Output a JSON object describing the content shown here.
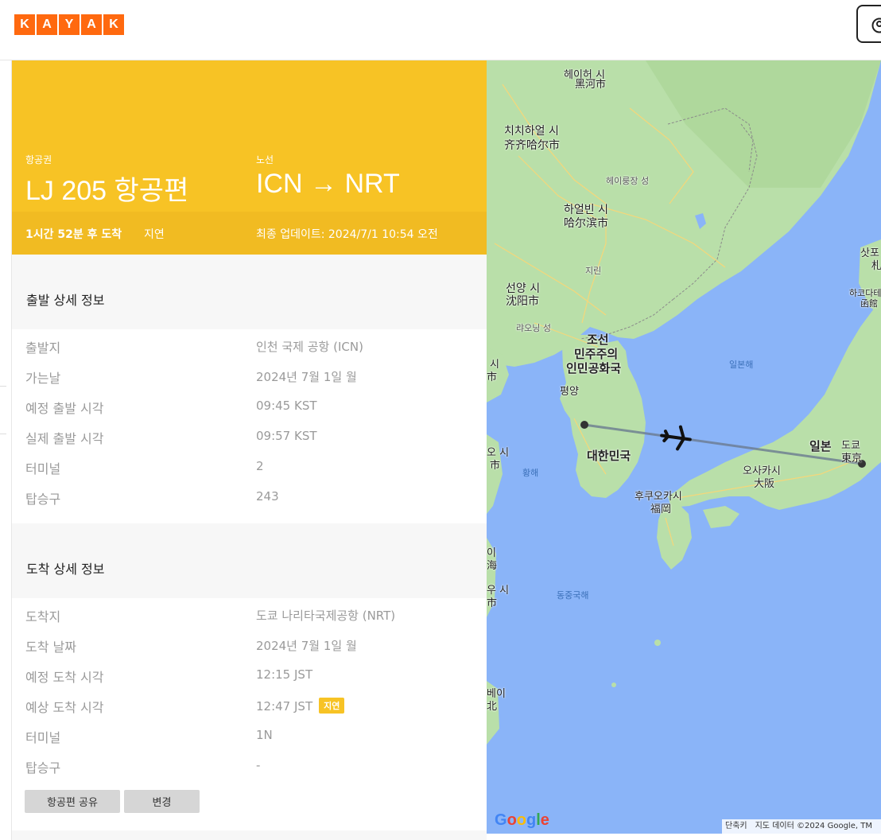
{
  "header": {
    "logo_letters": [
      "K",
      "A",
      "Y",
      "A",
      "K"
    ],
    "brand_color": "#ff690f"
  },
  "hero": {
    "flight_label": "항공권",
    "flight_title": "LJ 205 항공편",
    "route_label": "노선",
    "route_title": "ICN → NRT",
    "arrival_countdown": "1시간 52분 후 도착",
    "status": "지연",
    "last_update": "최종 업데이트: 2024/7/1 10:54 오전",
    "color": "#f7c325"
  },
  "departure": {
    "heading": "출발 상세 정보",
    "rows": [
      {
        "label": "출발지",
        "value": "인천 국제 공항 (ICN)"
      },
      {
        "label": "가는날",
        "value": "2024년 7월 1일 월"
      },
      {
        "label": "예정 출발 시각",
        "value": "09:45 KST"
      },
      {
        "label": "실제 출발 시각",
        "value": "09:57 KST"
      },
      {
        "label": "터미널",
        "value": "2"
      },
      {
        "label": "탑승구",
        "value": "243"
      }
    ]
  },
  "arrival": {
    "heading": "도착 상세 정보",
    "rows": [
      {
        "label": "도착지",
        "value": "도쿄 나리타국제공항 (NRT)"
      },
      {
        "label": "도착 날짜",
        "value": "2024년 7월 1일 월"
      },
      {
        "label": "예정 도착 시각",
        "value": "12:15 JST"
      },
      {
        "label": "예상 도착 시각",
        "value": "12:47 JST",
        "badge": "지연"
      },
      {
        "label": "터미널",
        "value": "1N"
      },
      {
        "label": "탑승구",
        "value": "-"
      }
    ]
  },
  "actions": {
    "share_label": "항공편 공유",
    "change_label": "변경"
  },
  "map": {
    "labels": {
      "heihe": "헤이허 시",
      "heihe_cn": "黑河市",
      "qiqihar": "치치하얼 시",
      "qiqihar_cn": "齐齐哈尔市",
      "heilongjiang": "헤이룽장 성",
      "harbin": "하얼빈 시",
      "harbin_cn": "哈尔滨市",
      "jilin": "지린",
      "shenyang": "선양 시",
      "shenyang_cn": "沈阳市",
      "liaoning": "랴오닝 성",
      "dprk_1": "조선",
      "dprk_2": "민주주의",
      "dprk_3": "인민공화국",
      "pyongyang": "평양",
      "sea_of_japan": "일본해",
      "korea": "대한민국",
      "yellow_sea": "황해",
      "japan": "일본",
      "tokyo": "도쿄",
      "tokyo_jp": "東京",
      "osaka": "오사카시",
      "osaka_jp": "大阪",
      "fukuoka": "후쿠오카시",
      "fukuoka_jp": "福岡",
      "east_china_sea": "동중국해",
      "sapporo": "삿포",
      "sapporo_jp": "札",
      "hakodate": "하코다테",
      "hakodate_jp": "函館",
      "edge_1": "시",
      "edge_1b": "市",
      "edge_2": "오 시",
      "edge_2b": "市",
      "edge_3": "이",
      "edge_3b": "海",
      "edge_4": "우 시",
      "edge_4b": "市",
      "edge_5": "베이",
      "edge_5b": "北"
    },
    "google": [
      "G",
      "o",
      "o",
      "g",
      "l",
      "e"
    ],
    "shortcuts": "단축키",
    "attribution": "지도 데이터 ©2024 Google, TM"
  }
}
